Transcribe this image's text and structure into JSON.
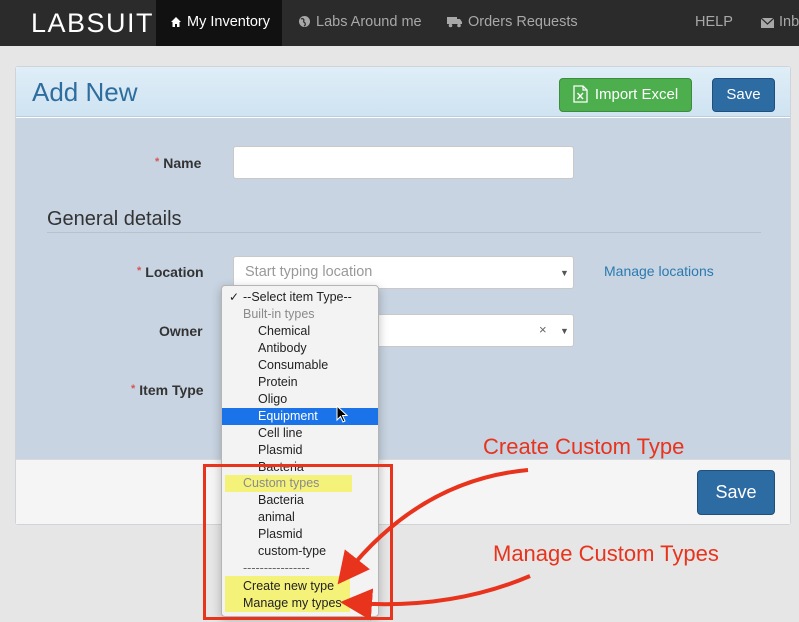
{
  "navbar": {
    "brand": "LABSUIT",
    "items": [
      {
        "label": "My Inventory",
        "icon": "home-icon",
        "active": true
      },
      {
        "label": "Labs Around me",
        "icon": "globe-icon"
      },
      {
        "label": "Orders Requests",
        "icon": "truck-icon"
      }
    ],
    "help": "HELP",
    "inbox": "Inb",
    "inbox_icon": "envelope-icon"
  },
  "panel": {
    "title": "Add New",
    "import_excel": "Import Excel",
    "import_icon": "excel-file-icon",
    "save_top": "Save",
    "save_bottom": "Save"
  },
  "form": {
    "required_mark": "*",
    "name_label": "Name",
    "name_value": "",
    "section_title": "General details",
    "location_label": "Location",
    "location_placeholder": "Start typing location",
    "manage_locations": "Manage locations",
    "owner_label": "Owner",
    "owner_clear": "×",
    "item_type_label": "Item Type"
  },
  "dropdown": {
    "selected_check": "✓",
    "placeholder": "--Select item Type--",
    "builtin_group": "Built-in types",
    "builtin_items": [
      "Chemical",
      "Antibody",
      "Consumable",
      "Protein",
      "Oligo",
      "Equipment",
      "Cell line",
      "Plasmid",
      "Bacteria"
    ],
    "highlighted_item": "Equipment",
    "custom_group": "Custom types",
    "custom_items": [
      "Bacteria",
      "animal",
      "Plasmid",
      "custom-type"
    ],
    "separator": "----------------",
    "create_new": "Create new type",
    "manage_types": "Manage my types"
  },
  "annotations": {
    "create": "Create Custom Type",
    "manage": "Manage Custom Types",
    "color": "#e8331d"
  },
  "colors": {
    "navbar": "#2b2b2b",
    "primary": "#2d6ba3",
    "success": "#4cae4c",
    "highlight": "#f5f27a",
    "selection": "#1a73e8"
  }
}
